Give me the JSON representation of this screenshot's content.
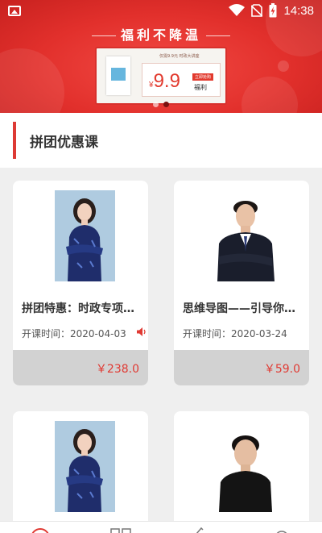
{
  "status_bar": {
    "time": "14:38"
  },
  "banner": {
    "title": "福利不降温",
    "ad_sub": "仅需9.9元 时政大讲座",
    "ad_tag": "立即抢购",
    "ad_price_symbol": "¥",
    "ad_price": "9.9",
    "ad_sign": "福利",
    "slide_count": 2,
    "active_slide": 2
  },
  "section": {
    "title": "拼团优惠课"
  },
  "courses": [
    {
      "title": "拼团特惠：时政专项…",
      "date": "开课时间：2020-04-03",
      "price": "￥238.0",
      "photo": "teacher-woman-photo"
    },
    {
      "title": "思维导图——引导你…",
      "date": "开课时间：2020-03-24",
      "price": "￥59.0",
      "photo": "teacher-man-photo"
    },
    {
      "title": "",
      "date": "",
      "price": "",
      "photo": "teacher-woman-photo"
    },
    {
      "title": "",
      "date": "",
      "price": "",
      "photo": "teacher-young-man-photo"
    }
  ],
  "colors": {
    "accent": "#dd3a35",
    "price": "#e03a33",
    "banner": "#e2302c"
  }
}
